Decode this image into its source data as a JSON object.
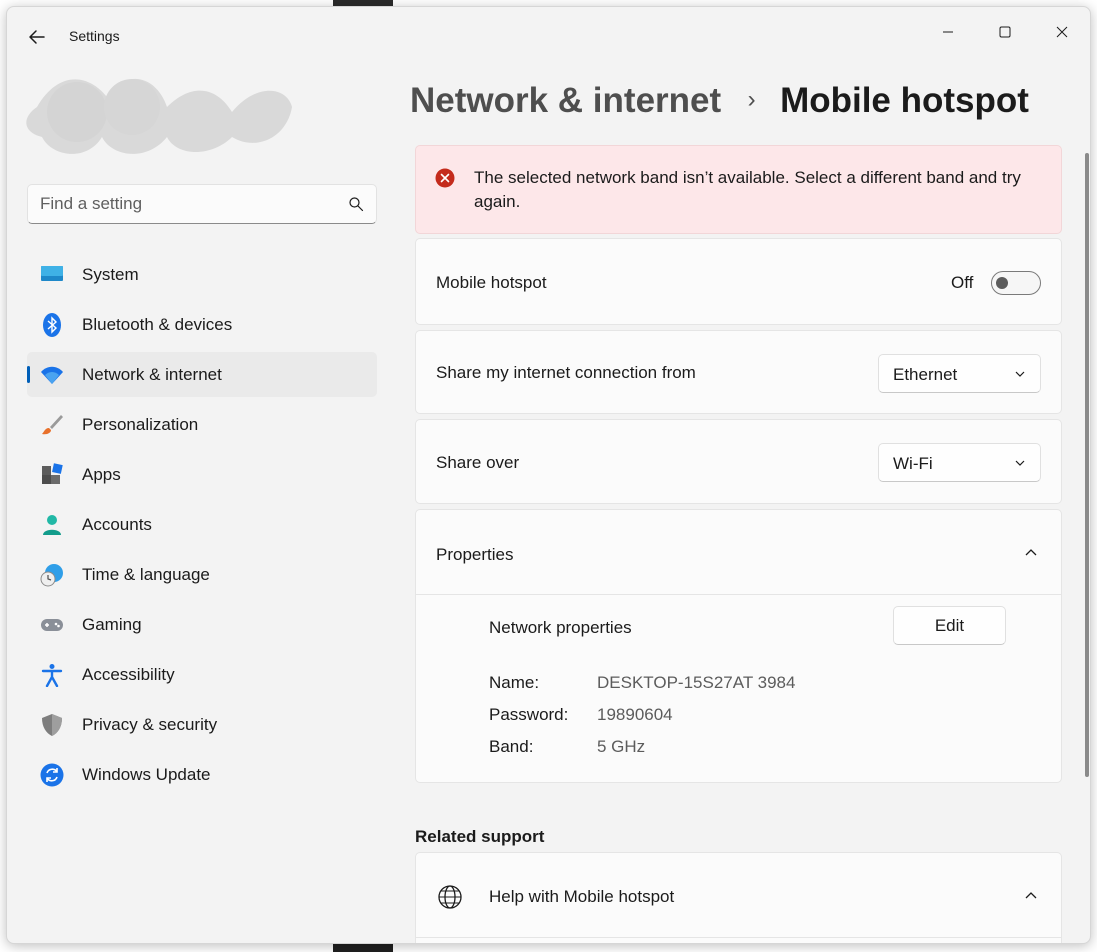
{
  "window": {
    "title": "Settings"
  },
  "icons": {
    "back": "back-arrow-icon",
    "minimize": "minimize-icon",
    "maximize": "maximize-icon",
    "close": "close-icon",
    "search": "search-icon",
    "error": "error-icon",
    "chevron_down": "chevron-down-icon",
    "chevron_up": "chevron-up-icon",
    "globe": "globe-icon"
  },
  "search": {
    "placeholder": "Find a setting"
  },
  "sidebar": {
    "items": [
      {
        "label": "System",
        "icon": "system-icon"
      },
      {
        "label": "Bluetooth & devices",
        "icon": "bluetooth-icon"
      },
      {
        "label": "Network & internet",
        "icon": "wifi-icon",
        "active": true
      },
      {
        "label": "Personalization",
        "icon": "brush-icon"
      },
      {
        "label": "Apps",
        "icon": "apps-icon"
      },
      {
        "label": "Accounts",
        "icon": "accounts-icon"
      },
      {
        "label": "Time & language",
        "icon": "time-language-icon"
      },
      {
        "label": "Gaming",
        "icon": "gamepad-icon"
      },
      {
        "label": "Accessibility",
        "icon": "accessibility-icon"
      },
      {
        "label": "Privacy & security",
        "icon": "shield-icon"
      },
      {
        "label": "Windows Update",
        "icon": "windows-update-icon"
      }
    ]
  },
  "breadcrumb": {
    "parent": "Network & internet",
    "separator": "›",
    "current": "Mobile hotspot"
  },
  "error": {
    "message": "The selected network band isn’t available. Select a different band and try again."
  },
  "hotspot": {
    "label": "Mobile hotspot",
    "state": "Off"
  },
  "share_from": {
    "label": "Share my internet connection from",
    "value": "Ethernet"
  },
  "share_over": {
    "label": "Share over",
    "value": "Wi-Fi"
  },
  "properties": {
    "label": "Properties",
    "network_properties_label": "Network properties",
    "edit_label": "Edit",
    "name_key": "Name:",
    "name_value": "DESKTOP-15S27AT 3984",
    "password_key": "Password:",
    "password_value": "19890604",
    "band_key": "Band:",
    "band_value": "5 GHz"
  },
  "related_support": {
    "title": "Related support",
    "help_label": "Help with Mobile hotspot"
  },
  "colors": {
    "accent": "#005fb8",
    "error_bg": "#fde7e9",
    "error_icon": "#c42b1c",
    "window_bg": "#f3f3f3",
    "card_bg": "#fbfbfb"
  }
}
